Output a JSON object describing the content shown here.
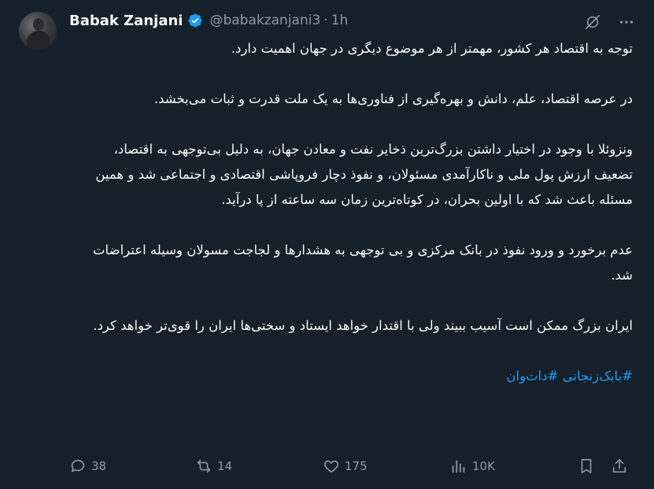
{
  "author": {
    "name": "Babak Zanjani",
    "handle": "@babakzanjani3",
    "separator": "·",
    "time": "1h"
  },
  "tweet": {
    "paragraphs": [
      "توجه به اقتصاد هر کشور، مهمتر از هر موضوع دیگری در جهان اهمیت دارد.",
      "در عرصه اقتصاد، علم، دانش و بهره‌گیری از فناوری‌ها به یک ملت قدرت و ثبات می‌بخشد.",
      "ونزوئلا با وجود در اختیار داشتن بزرگ‌ترین ذخایر نفت و معادن جهان، به دلیل بی‌توجهی به اقتصاد، تضعیف ارزش پول ملی و ناکارآمدی مسئولان، و نفوذ دچار فروپاشی اقتصادی و اجتماعی شد و همین مسئله باعث شد که با اولین بحران، در کوتاه‌ترین زمان سه ساعته از پا درآید.",
      "عدم برخورد و ورود نفوذ در بانک مرکزی و بی توجهی به هشدارها و لجاجت مسولان وسیله اعتراضات شد.",
      "ایران بزرگ ممکن است آسیب ببیند ولی با اقتدار خواهد ایستاد و سختی‌ها ایران را قوی‌تر خواهد کرد."
    ],
    "hashtags": "#بابک‌زنجانی #دات‌وان"
  },
  "actions": {
    "replies": "38",
    "reposts": "14",
    "likes": "175",
    "views": "10K"
  },
  "colors": {
    "background": "#15202b",
    "text": "#f7f9f9",
    "muted": "#8b98a5",
    "link": "#1d9bf0",
    "verified": "#1d9bf0"
  },
  "icons": [
    "verified-badge-icon",
    "grok-icon",
    "more-icon",
    "reply-icon",
    "repost-icon",
    "like-icon",
    "views-icon",
    "bookmark-icon",
    "share-icon"
  ]
}
